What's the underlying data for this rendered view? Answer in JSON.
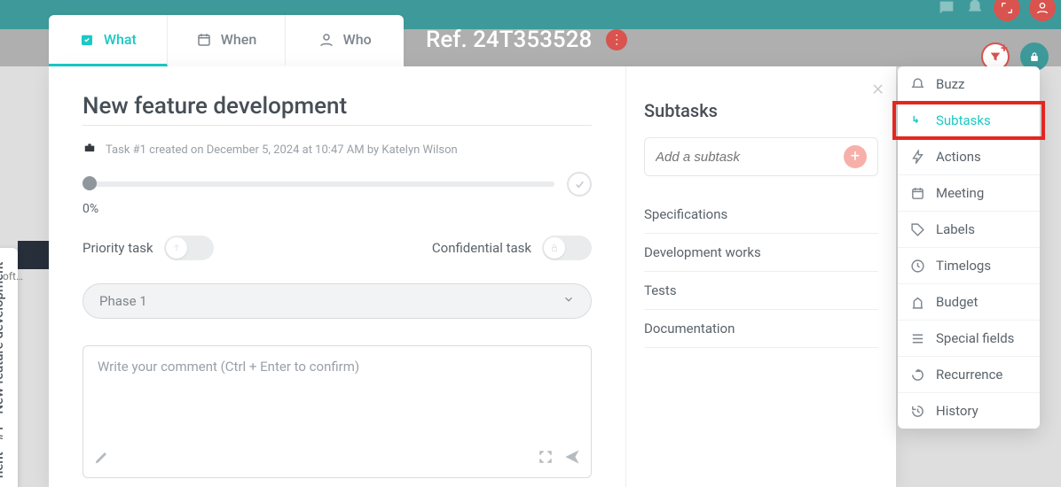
{
  "ref": "Ref. 24T353528",
  "tabs": {
    "what": "What",
    "when": "When",
    "who": "Who"
  },
  "sidetab": "nent - #1 - New feature development",
  "soft": "oft…",
  "task": {
    "title": "New feature development",
    "meta": "Task #1 created on December 5, 2024 at 10:47 AM by Katelyn Wilson",
    "progress_pct": "0%",
    "priority_label": "Priority task",
    "confidential_label": "Confidential task",
    "phase": "Phase 1",
    "comment_placeholder": "Write your comment (Ctrl + Enter to confirm)"
  },
  "subtasks": {
    "title": "Subtasks",
    "add_placeholder": "Add a subtask",
    "items": [
      "Specifications",
      "Development works",
      "Tests",
      "Documentation"
    ]
  },
  "menu": {
    "buzz": "Buzz",
    "subtasks": "Subtasks",
    "actions": "Actions",
    "meeting": "Meeting",
    "labels": "Labels",
    "timelogs": "Timelogs",
    "budget": "Budget",
    "specialfields": "Special fields",
    "recurrence": "Recurrence",
    "history": "History"
  }
}
